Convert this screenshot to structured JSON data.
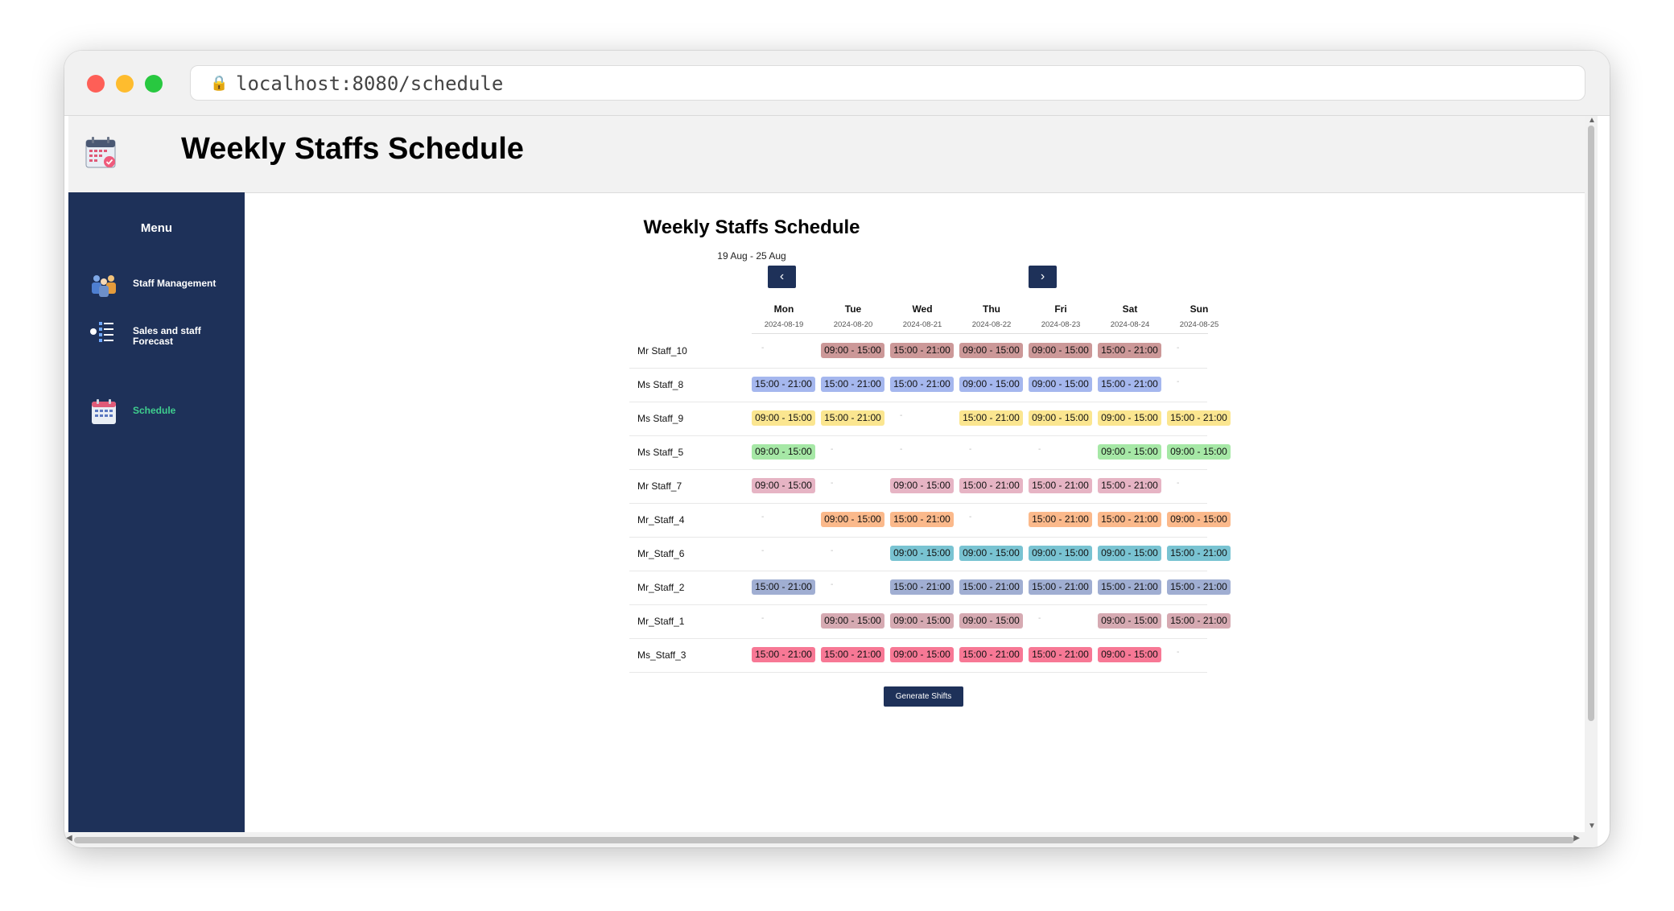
{
  "browser": {
    "url": "localhost:8080/schedule"
  },
  "app": {
    "title": "Weekly Staffs Schedule"
  },
  "sidebar": {
    "menu_title": "Menu",
    "items": [
      {
        "label": "Staff Management",
        "icon": "staff-management-icon",
        "active": false
      },
      {
        "label": "Sales and staff Forecast",
        "icon": "forecast-list-icon",
        "active": false
      },
      {
        "label": "Schedule",
        "icon": "calendar-icon",
        "active": true
      }
    ]
  },
  "schedule": {
    "title": "Weekly Staffs Schedule",
    "range": "19 Aug - 25 Aug",
    "prev_label": "‹",
    "next_label": "›",
    "days": [
      {
        "name": "Mon",
        "date": "2024-08-19"
      },
      {
        "name": "Tue",
        "date": "2024-08-20"
      },
      {
        "name": "Wed",
        "date": "2024-08-21"
      },
      {
        "name": "Thu",
        "date": "2024-08-22"
      },
      {
        "name": "Fri",
        "date": "2024-08-23"
      },
      {
        "name": "Sat",
        "date": "2024-08-24"
      },
      {
        "name": "Sun",
        "date": "2024-08-25"
      }
    ],
    "rows": [
      {
        "name": "Mr Staff_10",
        "color": "#cc9898",
        "shifts": [
          "-",
          "09:00 - 15:00",
          "15:00 - 21:00",
          "09:00 - 15:00",
          "09:00 - 15:00",
          "15:00 - 21:00",
          "-"
        ]
      },
      {
        "name": "Ms Staff_8",
        "color": "#a5b7ee",
        "shifts": [
          "15:00 - 21:00",
          "15:00 - 21:00",
          "15:00 - 21:00",
          "09:00 - 15:00",
          "09:00 - 15:00",
          "15:00 - 21:00",
          "-"
        ]
      },
      {
        "name": "Ms Staff_9",
        "color": "#fbe690",
        "shifts": [
          "09:00 - 15:00",
          "15:00 - 21:00",
          "-",
          "15:00 - 21:00",
          "09:00 - 15:00",
          "09:00 - 15:00",
          "15:00 - 21:00"
        ]
      },
      {
        "name": "Ms Staff_5",
        "color": "#a6e8a6",
        "shifts": [
          "09:00 - 15:00",
          "-",
          "-",
          "-",
          "-",
          "09:00 - 15:00",
          "09:00 - 15:00"
        ]
      },
      {
        "name": "Mr Staff_7",
        "color": "#e6b4c4",
        "shifts": [
          "09:00 - 15:00",
          "-",
          "09:00 - 15:00",
          "15:00 - 21:00",
          "15:00 - 21:00",
          "15:00 - 21:00",
          "-"
        ]
      },
      {
        "name": "Mr_Staff_4",
        "color": "#fbb98b",
        "shifts": [
          "-",
          "09:00 - 15:00",
          "15:00 - 21:00",
          "-",
          "15:00 - 21:00",
          "15:00 - 21:00",
          "09:00 - 15:00"
        ]
      },
      {
        "name": "Mr_Staff_6",
        "color": "#79c3d2",
        "shifts": [
          "-",
          "-",
          "09:00 - 15:00",
          "09:00 - 15:00",
          "09:00 - 15:00",
          "09:00 - 15:00",
          "15:00 - 21:00"
        ]
      },
      {
        "name": "Mr_Staff_2",
        "color": "#a0aed2",
        "shifts": [
          "15:00 - 21:00",
          "-",
          "15:00 - 21:00",
          "15:00 - 21:00",
          "15:00 - 21:00",
          "15:00 - 21:00",
          "15:00 - 21:00"
        ]
      },
      {
        "name": "Mr_Staff_1",
        "color": "#d6aab2",
        "shifts": [
          "-",
          "09:00 - 15:00",
          "09:00 - 15:00",
          "09:00 - 15:00",
          "-",
          "09:00 - 15:00",
          "15:00 - 21:00"
        ]
      },
      {
        "name": "Ms_Staff_3",
        "color": "#f77895",
        "shifts": [
          "15:00 - 21:00",
          "15:00 - 21:00",
          "09:00 - 15:00",
          "15:00 - 21:00",
          "15:00 - 21:00",
          "09:00 - 15:00",
          "-"
        ]
      }
    ],
    "generate_label": "Generate Shifts"
  }
}
